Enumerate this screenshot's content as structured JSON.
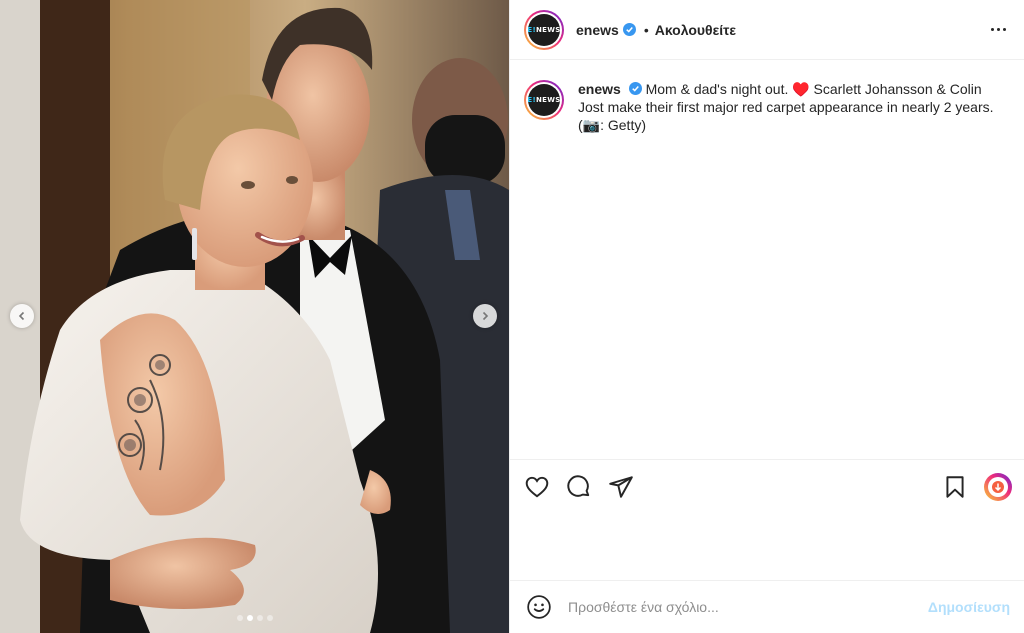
{
  "post": {
    "media": {
      "slide_count": 4,
      "active_slide": 1,
      "prev_icon": "chevron-left-icon",
      "next_icon": "chevron-right-icon"
    },
    "header": {
      "username": "enews",
      "verified": true,
      "separator": "•",
      "follow_label": "Ακολουθείτε",
      "avatar_text": "NEWS"
    },
    "caption": {
      "username": "enews",
      "text": "Mom & dad's night out. ♥️ Scarlett Johansson & Colin Jost make their first major red carpet appearance in nearly 2 years. (📷: Getty)"
    },
    "actions": {
      "like_icon": "heart-icon",
      "comment_icon": "comment-icon",
      "share_icon": "paper-plane-icon",
      "save_icon": "bookmark-icon",
      "boost_icon": "boost-icon"
    },
    "comment_bar": {
      "emoji_icon": "smiley-icon",
      "placeholder": "Προσθέστε ένα σχόλιο...",
      "publish_label": "Δημοσίευση"
    },
    "colors": {
      "verified_blue": "#3897f0",
      "publish_disabled": "#b2dffc",
      "text": "#262626",
      "muted": "#8e8e8e"
    }
  }
}
